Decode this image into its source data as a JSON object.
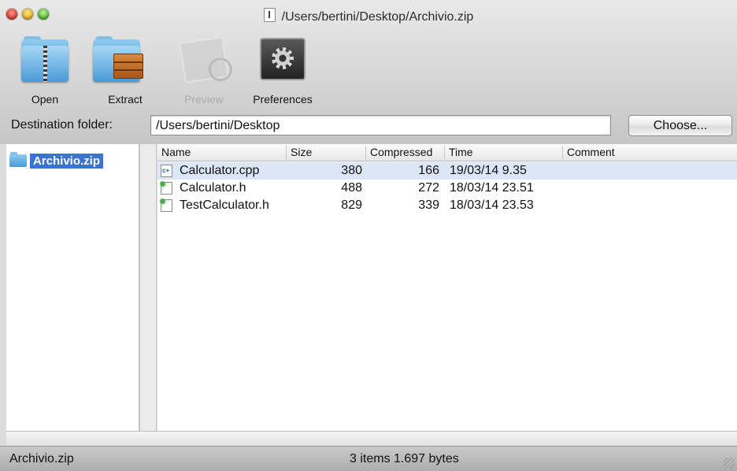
{
  "window": {
    "title": "/Users/bertini/Desktop/Archivio.zip"
  },
  "toolbar": {
    "items": [
      {
        "label": "Open",
        "icon": "zip-folder-icon",
        "enabled": true
      },
      {
        "label": "Extract",
        "icon": "folder-box-icon",
        "enabled": true
      },
      {
        "label": "Preview",
        "icon": "preview-icon",
        "enabled": false
      },
      {
        "label": "Preferences",
        "icon": "gear-icon",
        "enabled": true
      }
    ]
  },
  "destination": {
    "label": "Destination folder:",
    "value": "/Users/bertini/Desktop",
    "choose_label": "Choose..."
  },
  "sidebar": {
    "items": [
      {
        "label": "Archivio.zip",
        "icon": "folder-icon",
        "selected": true
      }
    ]
  },
  "file_list": {
    "columns": [
      "Name",
      "Size",
      "Compressed",
      "Time",
      "Comment"
    ],
    "rows": [
      {
        "name": "Calculator.cpp",
        "size": "380",
        "compressed": "166",
        "time": "19/03/14 9.35",
        "comment": "",
        "icon": "cpp-file-icon"
      },
      {
        "name": "Calculator.h",
        "size": "488",
        "compressed": "272",
        "time": "18/03/14 23.51",
        "comment": "",
        "icon": "header-file-icon"
      },
      {
        "name": "TestCalculator.h",
        "size": "829",
        "compressed": "339",
        "time": "18/03/14 23.53",
        "comment": "",
        "icon": "header-file-icon"
      }
    ]
  },
  "status": {
    "left": "Archivio.zip",
    "center": "3 items  1.697 bytes"
  },
  "colors": {
    "selection": "#3b72d5",
    "row_highlight": "#dbe6f7"
  }
}
